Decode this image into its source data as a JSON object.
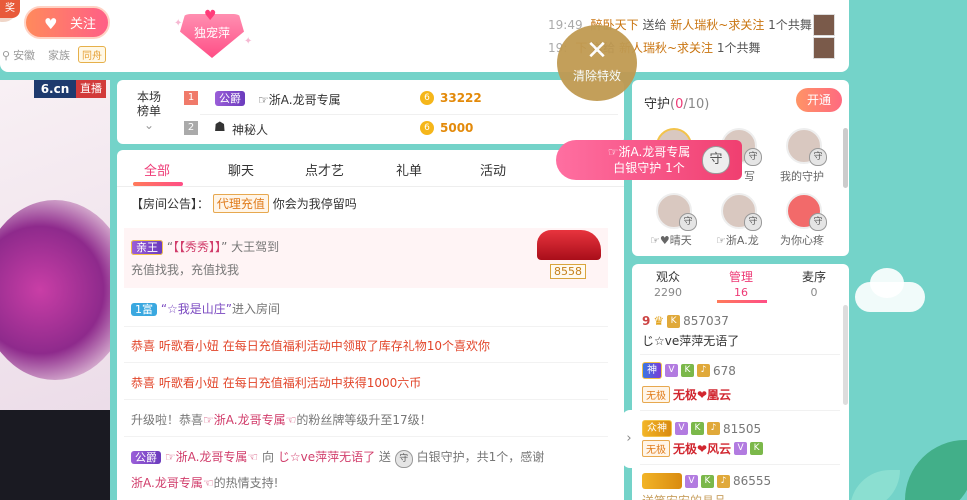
{
  "top": {
    "avatar_badge": "奖",
    "follow_label": "关注",
    "location": "安徽",
    "family_label": "家族",
    "family_tag": "同舟",
    "pet_label": "独宠萍"
  },
  "gift_ticker": [
    {
      "time": "19:49",
      "sender": "醉卧天下",
      "verb": "送给",
      "receiver": "新人瑞秋~求关注",
      "count": "1个",
      "gift": "共舞"
    },
    {
      "time": "19:",
      "sender": "下",
      "verb": "送给",
      "receiver": "新人瑞秋~求关注",
      "count": "1个",
      "gift": "共舞"
    }
  ],
  "clear_effects": {
    "icon": "close-icon",
    "label": "清除特效"
  },
  "video": {
    "logo": "6.cn",
    "live_badge": "直播"
  },
  "rank": {
    "title_line1": "本场",
    "title_line2": "榜单",
    "rows": [
      {
        "num": "1",
        "tag": "公爵",
        "name": "☞浙A.龙哥专属",
        "amount": "33222"
      },
      {
        "num": "2",
        "tag": "",
        "name": "神秘人",
        "amount": "5000"
      }
    ]
  },
  "tabs": [
    "全部",
    "聊天",
    "点才艺",
    "礼单",
    "活动"
  ],
  "chat": {
    "notice_prefix": "【房间公告】：",
    "notice_tag": "代理充值",
    "notice_text": "你会为我停留吗",
    "car_msg": {
      "badge": "亲王",
      "open_quote": "“",
      "name": "【【秀秀】】",
      "close_quote": "”",
      "text": "大王驾到",
      "line2": "充值找我，充值找我",
      "car_number": "8558"
    },
    "enter_msg": {
      "badge": "1富",
      "name": "“☆我是山庄”",
      "text": "进入房间"
    },
    "activity1": {
      "prefix": "恭喜",
      "name": "听歌看小妞",
      "text": "在每日充值福利活动中领取了库存礼物10个喜欢你"
    },
    "activity2": {
      "prefix": "恭喜",
      "name": "听歌看小妞",
      "text": "在每日充值福利活动中获得1000六币"
    },
    "levelup": {
      "prefix": "升级啦！恭喜",
      "name": "☞浙A.龙哥专属☜",
      "text": "的粉丝牌等级升至17级！"
    },
    "guard_msg": {
      "badge": "公爵",
      "from": "☞浙A.龙哥专属☜",
      "to_word": "向",
      "to": "じ☆ve萍萍无语了",
      "send_word": "送",
      "gift": "白银守护，共1个，感谢",
      "line2_name": "浙A.龙哥专属☜",
      "line2_text": "的热情支持!"
    }
  },
  "guard": {
    "title": "守护",
    "count_open": "(",
    "count_cur": "0",
    "count_total": "/10)",
    "open_label": "开通",
    "members": [
      {
        "name": ""
      },
      {
        "name": "写"
      },
      {
        "name": "我的守护"
      },
      {
        "name": "☞♥晴天"
      },
      {
        "name": "☞浙A.龙"
      },
      {
        "name": "为你心疼"
      }
    ],
    "popup_name": "☞浙A.龙哥专属",
    "popup_text": "白银守护",
    "popup_count": "1个",
    "shield_glyph": "守"
  },
  "users": {
    "tabs": [
      {
        "label": "观众",
        "count": "2290"
      },
      {
        "label": "管理",
        "count": "16"
      },
      {
        "label": "麦序",
        "count": "0"
      }
    ],
    "rows": [
      {
        "rank": "9",
        "id": "857037",
        "name": "じ☆ve萍萍无语了"
      },
      {
        "crown": "神",
        "tag": "无极",
        "id": "678",
        "name": "无极❤凰云"
      },
      {
        "crown": "众神",
        "tag": "无极",
        "id": "81505",
        "name": "无极❤风云"
      },
      {
        "crown": "",
        "id": "86555",
        "name": "送笑安安的县品"
      }
    ],
    "collapse_icon": "›"
  },
  "colors": {
    "accent": "#ee3a76",
    "bg": "#74d3c9",
    "gold": "#c09a52"
  }
}
